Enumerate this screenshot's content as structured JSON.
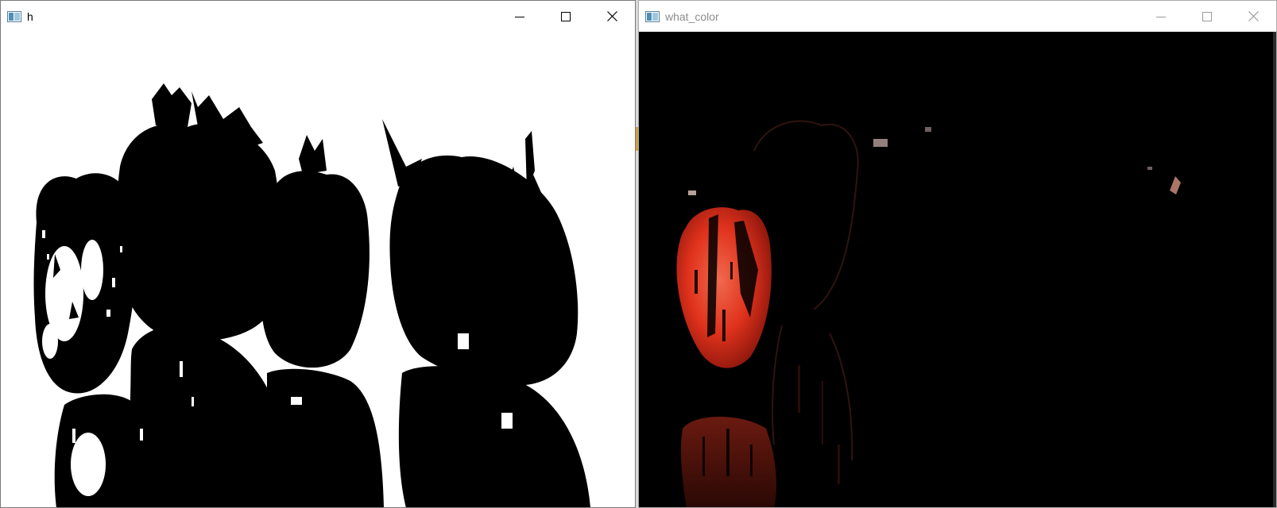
{
  "windows": [
    {
      "id": "h",
      "title": "h",
      "state": "active",
      "content": "binary-threshold-image"
    },
    {
      "id": "what_color",
      "title": "what_color",
      "state": "inactive",
      "content": "color-mask-image"
    }
  ],
  "icons": {
    "app": "opencv-window-icon",
    "minimize": "minimize-icon",
    "maximize": "maximize-icon",
    "close": "close-icon"
  },
  "colors": {
    "mask_background": "#000000",
    "threshold_background": "#ffffff",
    "threshold_foreground": "#000000",
    "detected_red": "#e0321c"
  }
}
